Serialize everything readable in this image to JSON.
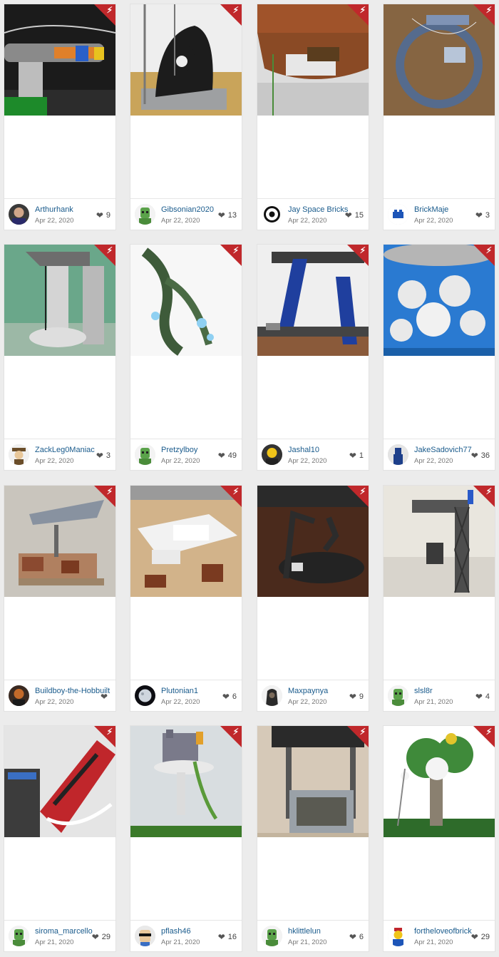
{
  "cards": [
    {
      "user": "Arthurhank",
      "date": "Apr 22, 2020",
      "likes": "9",
      "image": "lego-gun-scene",
      "avatar": "avatar-portrait"
    },
    {
      "user": "Gibsonian2020",
      "date": "Apr 22, 2020",
      "likes": "13",
      "image": "lego-hanging-seat",
      "avatar": "avatar-green-head"
    },
    {
      "user": "Jay Space Bricks",
      "date": "Apr 22, 2020",
      "likes": "15",
      "image": "lego-ship-hull",
      "avatar": "avatar-lion-logo"
    },
    {
      "user": "BrickMaje",
      "date": "Apr 22, 2020",
      "likes": "3",
      "image": "lego-blue-ring",
      "avatar": "avatar-blue-brick"
    },
    {
      "user": "ZackLeg0Maniac",
      "date": "Apr 22, 2020",
      "likes": "3",
      "image": "lego-grey-arch",
      "avatar": "avatar-minifig-hat"
    },
    {
      "user": "Pretzylboy",
      "date": "Apr 22, 2020",
      "likes": "49",
      "image": "lego-dragon",
      "avatar": "avatar-green-head"
    },
    {
      "user": "Jashal10",
      "date": "Apr 22, 2020",
      "likes": "1",
      "image": "lego-blue-crane",
      "avatar": "avatar-yellow-minifig"
    },
    {
      "user": "JakeSadovich77",
      "date": "Apr 22, 2020",
      "likes": "36",
      "image": "lego-clouds-city",
      "avatar": "avatar-blue-figure"
    },
    {
      "user": "Buildboy-the-Hobbuilt",
      "date": "Apr 22, 2020",
      "likes": "",
      "image": "lego-star-destroyer",
      "avatar": "avatar-dark-minifig"
    },
    {
      "user": "Plutonian1",
      "date": "Apr 22, 2020",
      "likes": "6",
      "image": "lego-white-ship",
      "avatar": "avatar-planet"
    },
    {
      "user": "Maxpaynya",
      "date": "Apr 22, 2020",
      "likes": "9",
      "image": "lego-dark-swing",
      "avatar": "avatar-hooded-figure"
    },
    {
      "user": "slsl8r",
      "date": "Apr 21, 2020",
      "likes": "4",
      "image": "lego-crane-tower",
      "avatar": "avatar-green-head"
    },
    {
      "user": "siroma_marcello",
      "date": "Apr 21, 2020",
      "likes": "29",
      "image": "lego-red-train",
      "avatar": "avatar-green-head"
    },
    {
      "user": "pflash46",
      "date": "Apr 21, 2020",
      "likes": "16",
      "image": "lego-floating-castle",
      "avatar": "avatar-sunglasses-face"
    },
    {
      "user": "hklittlelun",
      "date": "Apr 21, 2020",
      "likes": "6",
      "image": "lego-swing-frame",
      "avatar": "avatar-green-head"
    },
    {
      "user": "fortheloveofbrick",
      "date": "Apr 21, 2020",
      "likes": "29",
      "image": "lego-tree-island",
      "avatar": "avatar-classic-minifig"
    }
  ],
  "icons": {
    "badge": "lightning-bolt-icon",
    "like": "heart-icon"
  },
  "colors": {
    "badge": "#c0282b",
    "username": "#1a5b8c",
    "date": "#777777",
    "background": "#ececec"
  }
}
